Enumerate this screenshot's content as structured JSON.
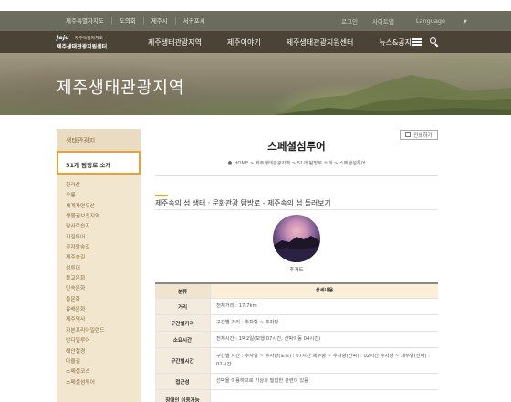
{
  "topbar": {
    "left_links": [
      "제주특별자치도",
      "도의회",
      "제주시",
      "서귀포시"
    ],
    "right_links": [
      "로그인",
      "사이트맵",
      "Language"
    ]
  },
  "logo": {
    "brand": "Jeju",
    "brand_sub": "제주특별자치도",
    "org": "제주생태관광지원센터"
  },
  "nav": {
    "items": [
      "제주생태관광지역",
      "제주이야기",
      "제주생태관광지원센터",
      "뉴스&공지"
    ]
  },
  "hero": {
    "title": "제주생태관광지역"
  },
  "sidebar": {
    "section": "생태관광지",
    "active": "51개 탐방로 소개",
    "items": [
      "한라산",
      "오름",
      "세계자연유산",
      "생물권보전지역",
      "람사르습지",
      "지질투어",
      "곶자왈숲길",
      "제주숲길",
      "섬투어",
      "불교문화",
      "민속문화",
      "돌문화",
      "유배문화",
      "제주역사",
      "카본프리아일랜드",
      "반다일루어",
      "해안절경",
      "마을길",
      "스페셜코스",
      "스페셜섬투어"
    ]
  },
  "content": {
    "print_label": "인쇄하기",
    "title": "스페셜섬투어",
    "breadcrumb": "HOME > 제주생태관광지역 > 51개 탐방로 소개 > 스페셜섬투어",
    "section_title": "제주속의 섬 생태 · 문화관광 탐방로 - 제주속의 섬 둘러보기",
    "photo_caption": "추자도",
    "table": {
      "head": [
        "분류",
        "상세내용"
      ],
      "rows": [
        [
          "거리",
          "전체거리 : 17.7km"
        ],
        [
          "구간별거리",
          "구간별 거리 : 추자항 ~ 추자항"
        ],
        [
          "소요시간",
          "전체시간 : 1박2일(보행 07시간, 선박이동 04시간)"
        ],
        [
          "구간별시간",
          "구간별 시간 : 추자항 ~ 추자항(도보) : 07시간 제주항 ~ 추자항(선박) : 02시간 추자항 ~ 제주항(선박) : 02시간"
        ],
        [
          "접근성",
          "선박을 이용하므로 기상과 밀접한 관련이 있음"
        ],
        [
          "장애인 이용가능",
          ""
        ]
      ]
    }
  },
  "colors": {
    "accent": "#f0a028",
    "nav_bg": "#4a4336",
    "sidebar_bg": "#f3e6cf"
  },
  "icons": [
    "hamburger-icon",
    "search-icon",
    "print-icon",
    "home-icon",
    "chevron-down-icon"
  ]
}
